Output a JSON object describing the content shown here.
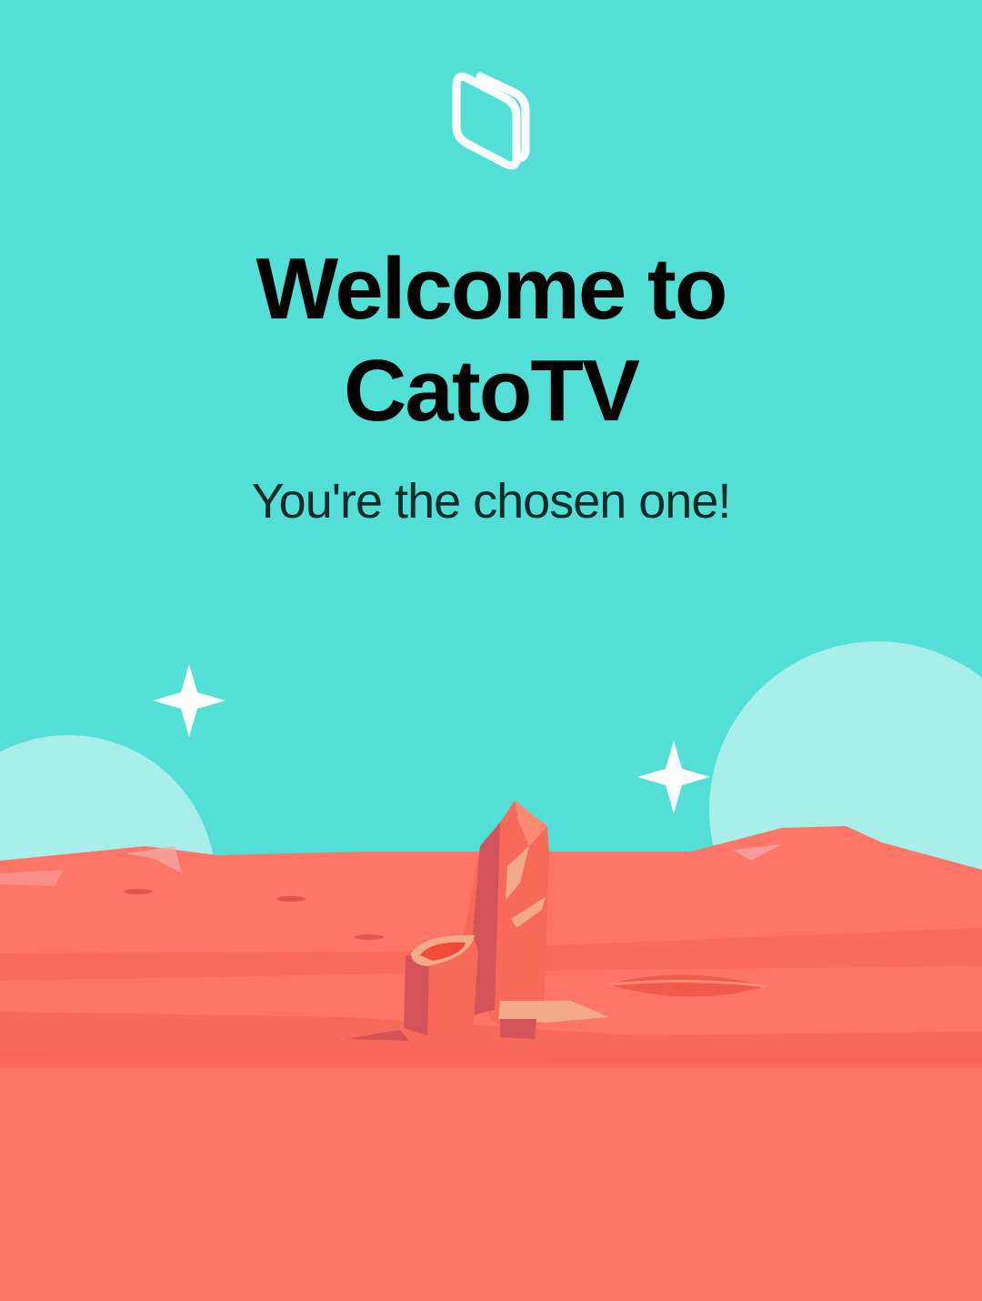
{
  "app": {
    "logo_icon": "book-logo-icon"
  },
  "welcome": {
    "title_line_1": "Welcome to",
    "title_line_2": "CatoTV",
    "subtitle": "You're the chosen one!"
  },
  "colors": {
    "sky": "#54dfd6",
    "moon": "#a8efeb",
    "ground": "#ff7566",
    "ground_shadow": "#f46452",
    "rock": "#f76a58",
    "rock_dark": "#d4525a",
    "rock_highlight": "#f2ab86",
    "star": "#ffffff"
  },
  "illustration": {
    "type": "desert-landscape",
    "elements": [
      "moon",
      "moon",
      "star",
      "star",
      "rock-spire",
      "crater"
    ]
  }
}
